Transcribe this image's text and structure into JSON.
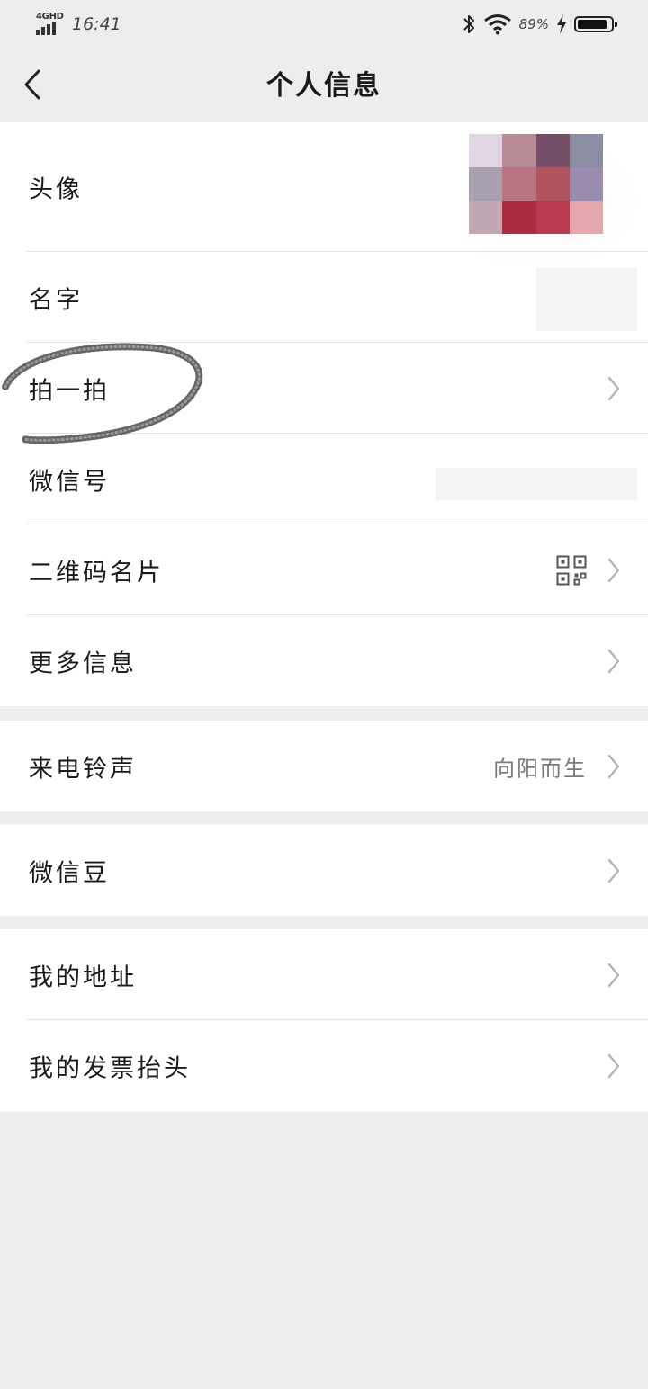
{
  "status_bar": {
    "network": "4GHD",
    "time": "16:41",
    "battery_percent": "89%",
    "battery_level": 0.89,
    "icons": [
      "bluetooth-icon",
      "wifi-icon",
      "charging-bolt-icon",
      "battery-icon"
    ]
  },
  "header": {
    "title": "个人信息",
    "back_icon": "chevron-left-icon"
  },
  "groups": [
    {
      "rows": [
        {
          "label": "头像",
          "value": "",
          "extra": "avatar-image"
        },
        {
          "label": "名字",
          "value": "",
          "extra": "blurred-name"
        },
        {
          "label": "拍一拍",
          "value": "",
          "chevron": true,
          "annotation": "hand-drawn-circle"
        },
        {
          "label": "微信号",
          "value": "",
          "extra": "blurred-id"
        },
        {
          "label": "二维码名片",
          "value": "",
          "icon": "qr-code-icon",
          "chevron": true
        },
        {
          "label": "更多信息",
          "value": "",
          "chevron": true
        }
      ]
    },
    {
      "rows": [
        {
          "label": "来电铃声",
          "value": "向阳而生",
          "chevron": true
        }
      ]
    },
    {
      "rows": [
        {
          "label": "微信豆",
          "value": "",
          "chevron": true
        }
      ]
    },
    {
      "rows": [
        {
          "label": "我的地址",
          "value": "",
          "chevron": true
        },
        {
          "label": "我的发票抬头",
          "value": "",
          "chevron": true
        }
      ]
    }
  ],
  "avatar_pixels": [
    "#e3d6e4",
    "#b88a95",
    "#744d66",
    "#8a8da3",
    "#a9a0b2",
    "#b97584",
    "#b0555f",
    "#9a8db0",
    "#c3a6b4",
    "#ab2c40",
    "#b73a50",
    "#e5a6ae"
  ],
  "colors": {
    "page_bg": "#ededed",
    "row_bg": "#ffffff",
    "divider": "#e2e2e2",
    "value_text": "#7a7a7a",
    "chevron": "#b2b2b2"
  }
}
